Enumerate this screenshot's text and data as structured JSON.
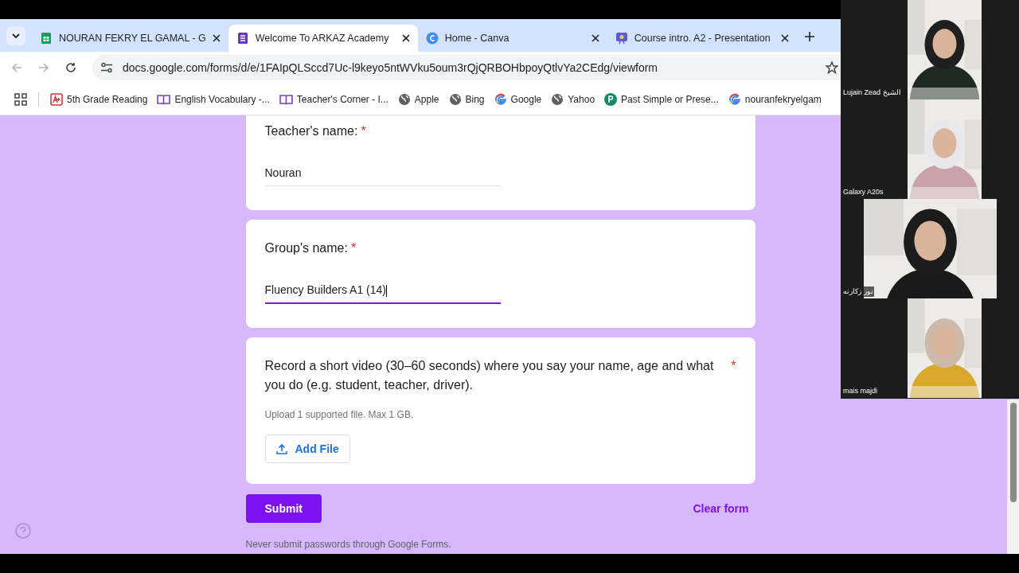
{
  "tabs": [
    {
      "label": "NOURAN FEKRY EL GAMAL - G",
      "kind": "sheets",
      "selected": false
    },
    {
      "label": "Welcome To ARKAZ Academy",
      "kind": "forms",
      "selected": true
    },
    {
      "label": "Home - Canva",
      "kind": "canva",
      "selected": false
    },
    {
      "label": "Course intro. A2 - Presentation",
      "kind": "slides",
      "selected": false
    }
  ],
  "address": "docs.google.com/forms/d/e/1FAIpQLSccd7Uc-l9keyo5ntWVku5oum3rQjQRBOHbpoyQtlvYa2CEdg/viewform",
  "bookmarks": [
    {
      "label": "5th Grade Reading",
      "kind": "aplus"
    },
    {
      "label": "English Vocabulary -...",
      "kind": "book"
    },
    {
      "label": "Teacher's Corner - I...",
      "kind": "book"
    },
    {
      "label": "Apple",
      "kind": "globe"
    },
    {
      "label": "Bing",
      "kind": "globe"
    },
    {
      "label": "Google",
      "kind": "google"
    },
    {
      "label": "Yahoo",
      "kind": "globe"
    },
    {
      "label": "Past Simple or Prese...",
      "kind": "p"
    },
    {
      "label": "nouranfekryelgam",
      "kind": "google"
    }
  ],
  "questions": [
    {
      "kind": "text",
      "label": "Teacher's name:",
      "required": "*",
      "value": "Nouran",
      "focused": false
    },
    {
      "kind": "text",
      "label": "Group's name:",
      "required": "*",
      "value": "Fluency Builders A1 (14)",
      "focused": true
    },
    {
      "kind": "upload",
      "label": "Record a short video (30–60 seconds) where you say your name, age and what you do (e.g. student, teacher, driver).",
      "required": "*",
      "hint": "Upload 1 supported file. Max 1 GB.",
      "button": "Add File"
    }
  ],
  "submit": "Submit",
  "clear": "Clear form",
  "footer": "Never submit passwords through Google Forms.",
  "participants": [
    {
      "name": "Lujain Zead الشيخ"
    },
    {
      "name": "Galaxy A20s"
    },
    {
      "name": "نور زكارنه"
    },
    {
      "name": "mais majdi"
    }
  ]
}
